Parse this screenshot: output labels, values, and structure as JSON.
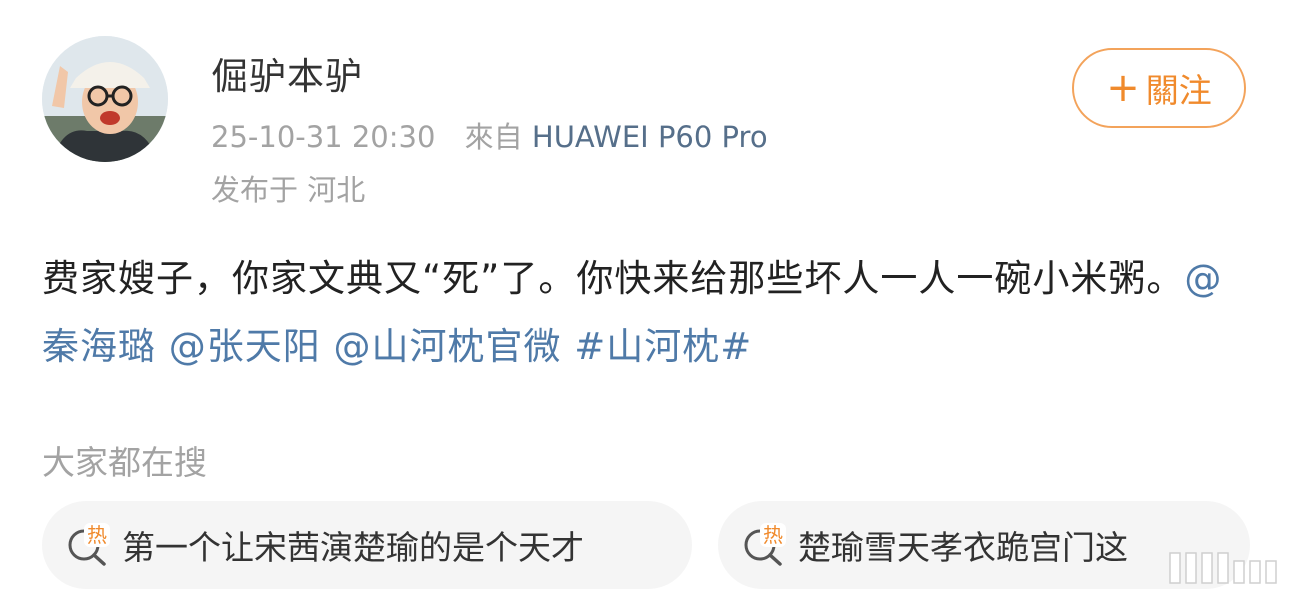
{
  "post": {
    "username": "倔驴本驴",
    "time": "25-10-31 20:30",
    "source_prefix": "來自",
    "device": "HUAWEI P60 Pro",
    "location": "发布于 河北",
    "follow_label": "關注",
    "text_plain": "费家嫂子，你家文典又“死”了。你快来给那些坏人一人一碗小米粥。",
    "mentions": [
      "@秦海璐",
      "@张天阳",
      "@山河枕官微"
    ],
    "hashtag": "#山河枕#"
  },
  "search": {
    "title": "大家都在搜",
    "hot_label": "热",
    "chips": [
      "第一个让宋茜演楚瑜的是个天才",
      "楚瑜雪天孝衣跪宫门这"
    ]
  },
  "colors": {
    "link": "#4f7aa8",
    "accent": "#f08a2c",
    "muted": "#a3a3a3"
  }
}
